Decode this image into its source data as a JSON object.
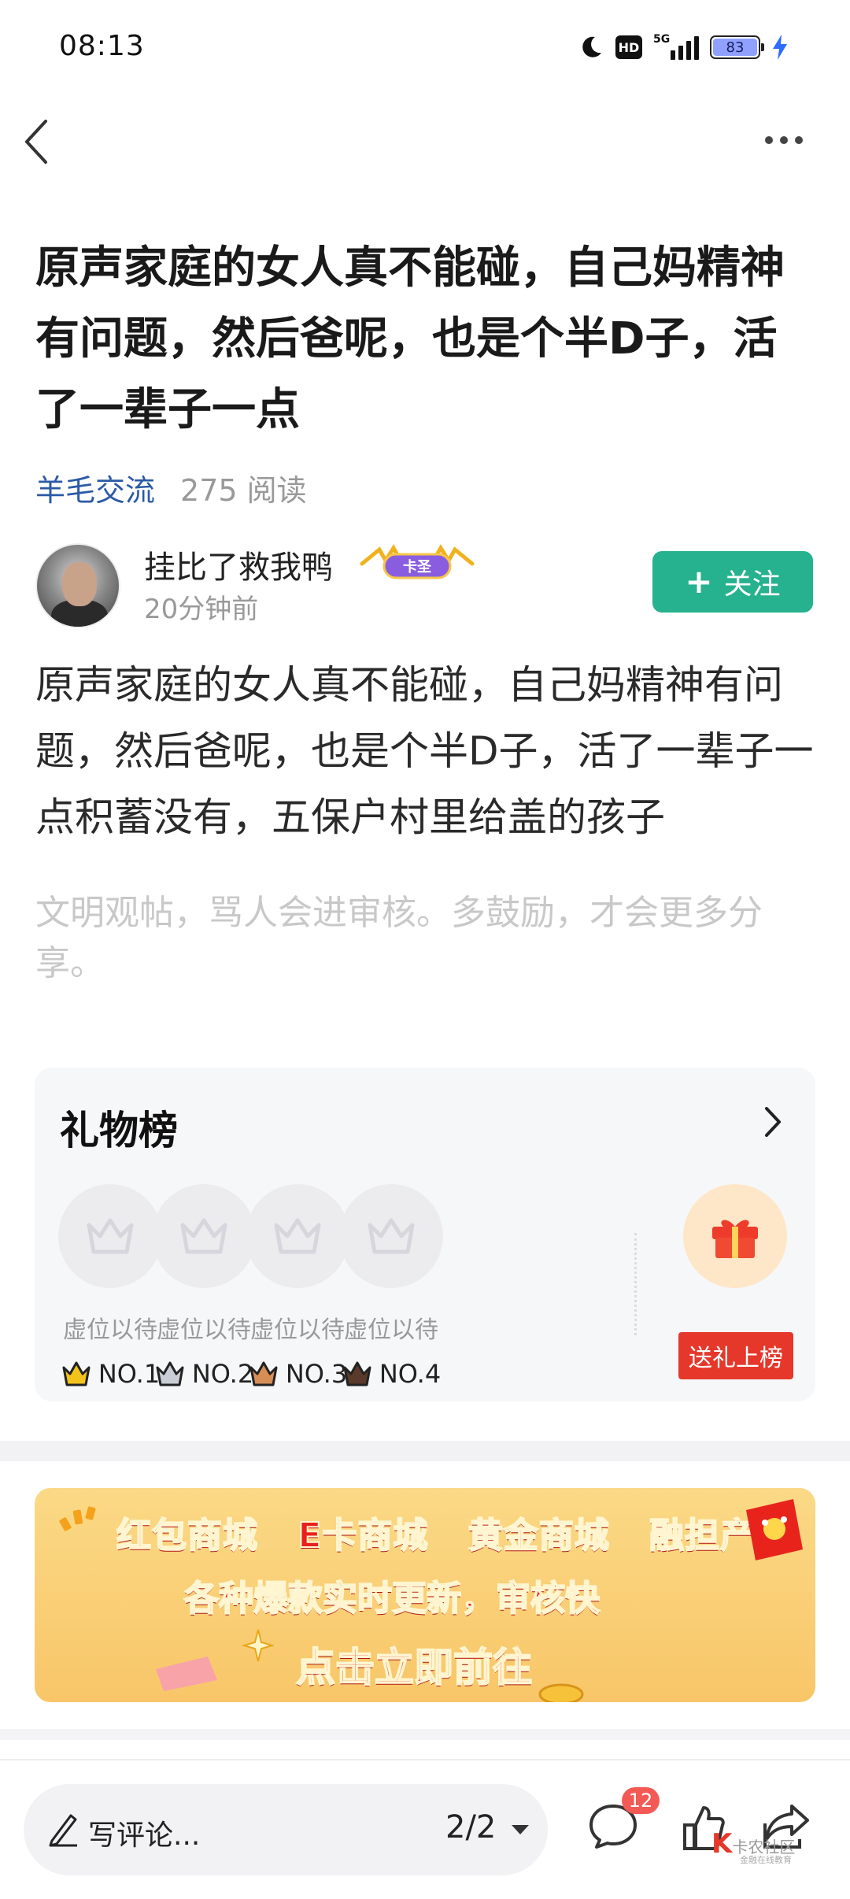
{
  "status": {
    "time": "08:13",
    "hd": "HD",
    "network": "5G",
    "battery": "83"
  },
  "post": {
    "title": "原声家庭的女人真不能碰，自己妈精神有问题，然后爸呢，也是个半D子，活了一辈子一点",
    "category": "羊毛交流",
    "reads": "275 阅读",
    "body": "原声家庭的女人真不能碰，自己妈精神有问题，然后爸呢，也是个半D子，活了一辈子一点积蓄没有，五保户村里给盖的孩子",
    "notice": "文明观帖，骂人会进审核。多鼓励，才会更多分享。"
  },
  "author": {
    "name": "挂比了救我鸭",
    "badge": "卡圣",
    "time": "20分钟前",
    "follow_label": "关注"
  },
  "gift_board": {
    "title": "礼物榜",
    "slots": [
      {
        "label": "虚位以待",
        "rank": "NO.1"
      },
      {
        "label": "虚位以待",
        "rank": "NO.2"
      },
      {
        "label": "虚位以待",
        "rank": "NO.3"
      },
      {
        "label": "虚位以待",
        "rank": "NO.4"
      }
    ],
    "send_label": "送礼上榜",
    "colors": {
      "gold": "#f2c31a",
      "silver": "#c8cdd6",
      "bronze": "#d78e55",
      "fourth": "#5a3a2a"
    }
  },
  "banner": {
    "line1": "红包商城 E卡商城 黄金商城 融担产品",
    "line2": "各种爆款实时更新，审核快",
    "line3": "点击立即前往"
  },
  "bottom": {
    "comment_placeholder": "写评论...",
    "page": "2/2",
    "comment_count": "12",
    "watermark": "卡农社区",
    "watermark_sub": "金融在线教育"
  },
  "icons": [
    "back-icon",
    "more-icon",
    "moon-icon",
    "signal-icon",
    "battery-icon",
    "charging-icon",
    "crown-icon",
    "chevron-right-icon",
    "gift-icon",
    "pen-icon",
    "comment-icon",
    "like-icon",
    "share-icon"
  ],
  "accent_colors": {
    "follow": "#26b28e",
    "category": "#2b5aa6",
    "gift_button": "#e5382b",
    "badge": "#f35a56"
  }
}
